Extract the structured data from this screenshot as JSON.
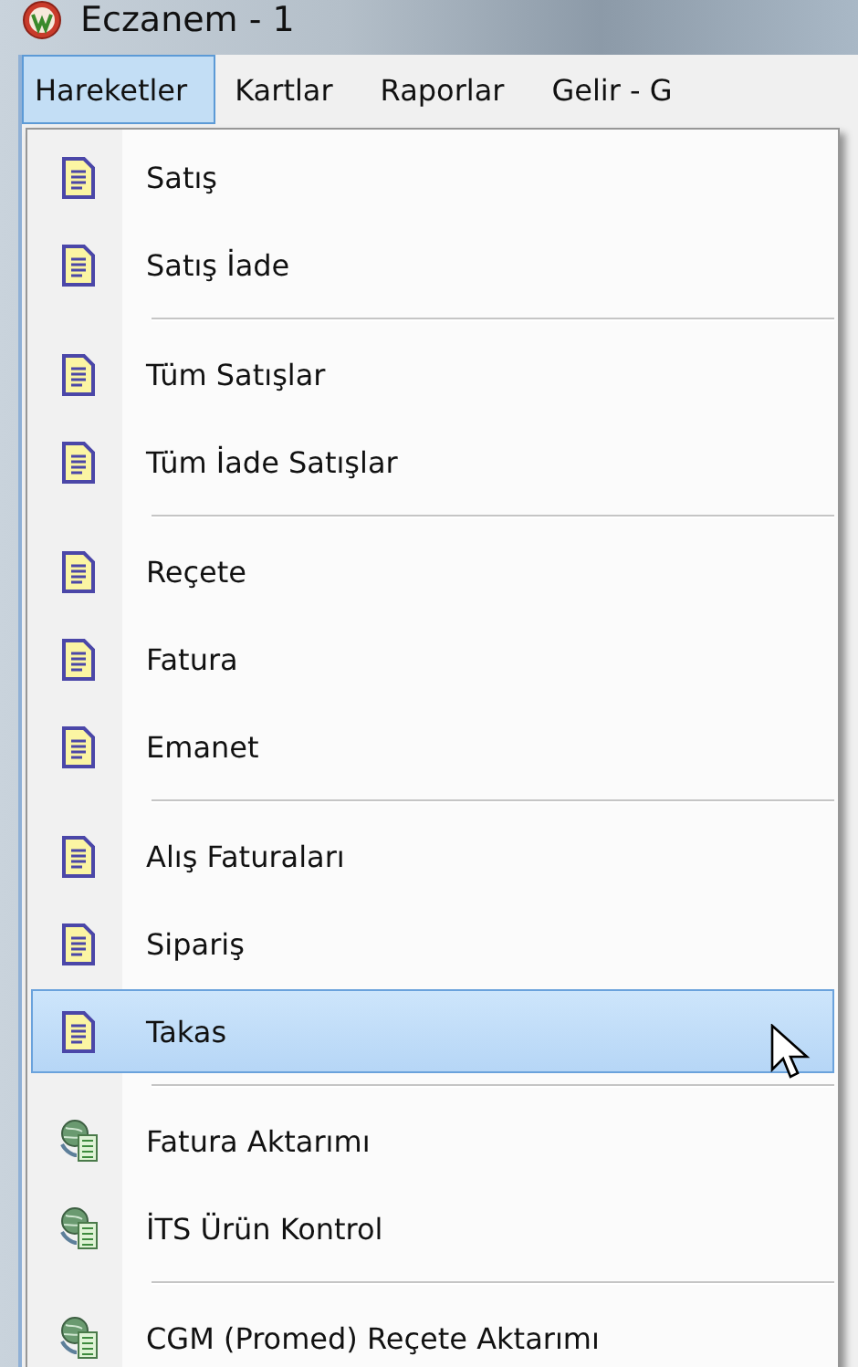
{
  "window": {
    "title": "Eczanem - 1"
  },
  "menubar": [
    {
      "label": "Hareketler",
      "selected": true
    },
    {
      "label": "Kartlar",
      "selected": false
    },
    {
      "label": "Raporlar",
      "selected": false
    },
    {
      "label": "Gelir - G",
      "selected": false
    }
  ],
  "menu": {
    "groups": [
      {
        "items": [
          {
            "label": "Satış",
            "kind": "document",
            "selected": false
          },
          {
            "label": "Satış İade",
            "kind": "document",
            "selected": false
          }
        ]
      },
      {
        "items": [
          {
            "label": "Tüm Satışlar",
            "kind": "document",
            "selected": false
          },
          {
            "label": "Tüm İade Satışlar",
            "kind": "document",
            "selected": false
          }
        ]
      },
      {
        "items": [
          {
            "label": "Reçete",
            "kind": "document",
            "selected": false
          },
          {
            "label": "Fatura",
            "kind": "document",
            "selected": false
          },
          {
            "label": "Emanet",
            "kind": "document",
            "selected": false
          }
        ]
      },
      {
        "items": [
          {
            "label": "Alış Faturaları",
            "kind": "document",
            "selected": false
          },
          {
            "label": "Sipariş",
            "kind": "document",
            "selected": false
          },
          {
            "label": "Takas",
            "kind": "document",
            "selected": true
          }
        ]
      },
      {
        "items": [
          {
            "label": "Fatura Aktarımı",
            "kind": "transfer",
            "selected": false
          },
          {
            "label": "İTS Ürün Kontrol",
            "kind": "transfer",
            "selected": false
          }
        ]
      },
      {
        "items": [
          {
            "label": "CGM (Promed) Reçete Aktarımı",
            "kind": "transfer",
            "selected": false
          }
        ]
      }
    ]
  }
}
